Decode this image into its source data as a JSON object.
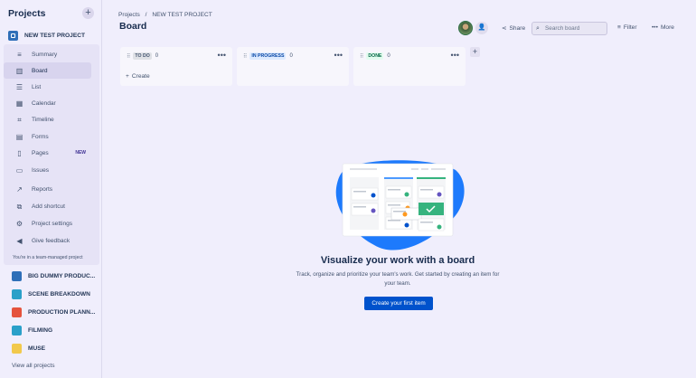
{
  "sidebar": {
    "header": "Projects",
    "add_label": "+",
    "current_project": {
      "label": "NEW TEST PROJECT",
      "color": "#2f6fb8"
    },
    "items": [
      {
        "label": "Summary",
        "icon": "summary-icon",
        "glyph": "≡"
      },
      {
        "label": "Board",
        "icon": "board-icon",
        "glyph": "▥"
      },
      {
        "label": "List",
        "icon": "list-icon",
        "glyph": "☰"
      },
      {
        "label": "Calendar",
        "icon": "calendar-icon",
        "glyph": "▦"
      },
      {
        "label": "Timeline",
        "icon": "timeline-icon",
        "glyph": "⌗"
      },
      {
        "label": "Forms",
        "icon": "forms-icon",
        "glyph": "▤"
      },
      {
        "label": "Pages",
        "icon": "pages-icon",
        "glyph": "▯",
        "badge": "NEW"
      },
      {
        "label": "Issues",
        "icon": "issues-icon",
        "glyph": "▭"
      },
      {
        "label": "Reports",
        "icon": "reports-icon",
        "glyph": "↗"
      },
      {
        "label": "Add shortcut",
        "icon": "add-shortcut-icon",
        "glyph": "⧉"
      },
      {
        "label": "Project settings",
        "icon": "settings-icon",
        "glyph": "⚙"
      },
      {
        "label": "Give feedback",
        "icon": "megaphone-icon",
        "glyph": "◀"
      }
    ],
    "team_note": "You're in a team-managed project",
    "other_projects": [
      {
        "label": "BIG DUMMY PRODUC...",
        "color": "#2f6fb8"
      },
      {
        "label": "SCENE BREAKDOWN",
        "color": "#2aa0c9"
      },
      {
        "label": "PRODUCTION PLANN...",
        "color": "#e5533d"
      },
      {
        "label": "FILMING",
        "color": "#2aa0c9"
      },
      {
        "label": "MUSE",
        "color": "#f2c94c"
      }
    ],
    "view_all": "View all projects"
  },
  "breadcrumb": {
    "root": "Projects",
    "separator": "/",
    "current": "NEW TEST PROJECT"
  },
  "page_title": "Board",
  "toolbar": {
    "share_label": "Share",
    "search_placeholder": "Search board",
    "filter_label": "Filter",
    "more_label": "More"
  },
  "columns": [
    {
      "name": "TO DO",
      "count": "0",
      "lozenge_bg": "#dfe1e6",
      "lozenge_fg": "#42526e",
      "create_label": "Create"
    },
    {
      "name": "IN PROGRESS",
      "count": "0",
      "lozenge_bg": "#deebff",
      "lozenge_fg": "#0747a6"
    },
    {
      "name": "DONE",
      "count": "0",
      "lozenge_bg": "#e3fcef",
      "lozenge_fg": "#006644"
    }
  ],
  "empty_state": {
    "title": "Visualize your work with a board",
    "description": "Track, organize and prioritize your team's work. Get started by creating an item for your team.",
    "button_label": "Create your first item"
  }
}
